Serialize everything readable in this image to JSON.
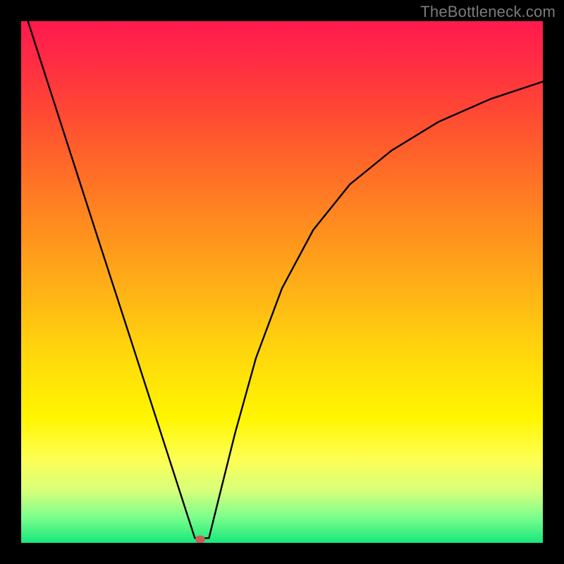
{
  "watermark": "TheBottleneck.com",
  "marker": {
    "x_frac": 0.343,
    "y_frac": 0.993,
    "color": "#cc5a55"
  },
  "chart_data": {
    "type": "line",
    "title": "",
    "xlabel": "",
    "ylabel": "",
    "xlim": [
      0,
      1
    ],
    "ylim": [
      0,
      1
    ],
    "background": "vertical rainbow gradient red→yellow→green",
    "series": [
      {
        "name": "left-branch",
        "x": [
          0.013,
          0.05,
          0.1,
          0.15,
          0.2,
          0.25,
          0.29,
          0.32,
          0.333
        ],
        "y": [
          1.0,
          0.885,
          0.73,
          0.575,
          0.421,
          0.266,
          0.142,
          0.049,
          0.009
        ]
      },
      {
        "name": "right-branch",
        "x": [
          0.36,
          0.38,
          0.41,
          0.45,
          0.5,
          0.56,
          0.63,
          0.71,
          0.8,
          0.9,
          1.0
        ],
        "y": [
          0.009,
          0.09,
          0.21,
          0.354,
          0.488,
          0.6,
          0.687,
          0.752,
          0.807,
          0.851,
          0.884
        ]
      },
      {
        "name": "valley-flat",
        "x": [
          0.333,
          0.36
        ],
        "y": [
          0.009,
          0.009
        ]
      }
    ],
    "marker_point": {
      "x": 0.343,
      "y": 0.007
    }
  }
}
